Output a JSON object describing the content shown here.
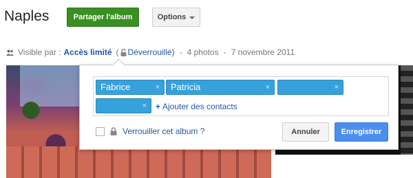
{
  "album": {
    "title": "Naples",
    "share_label": "Partager l'album",
    "options_label": "Options"
  },
  "visibility": {
    "prefix": "Visible par :",
    "access": "Accès limité",
    "open_paren": "(",
    "unlocked": "Déverrouillé)",
    "sep1": "-",
    "photos": "4 photos",
    "sep2": "-",
    "date": "7 novembre 2011"
  },
  "popup": {
    "chips": [
      {
        "label": "Fabrice",
        "remove": "×"
      },
      {
        "label": "Patricia",
        "remove": "×"
      },
      {
        "label": "",
        "remove": "×"
      },
      {
        "label": "",
        "remove": "×"
      }
    ],
    "add_contacts": "Ajouter des contacts",
    "add_plus": "+",
    "lock_label": "Verrouiller cet album ?",
    "cancel_label": "Annuler",
    "save_label": "Enregistrer"
  },
  "icons": {
    "people": "people-icon",
    "lock": "lock-icon",
    "chevron": "chevron-down-icon"
  },
  "colors": {
    "share": "#3a8f22",
    "chip": "#36a1db",
    "link": "#2255aa",
    "save": "#4b8ef0"
  }
}
